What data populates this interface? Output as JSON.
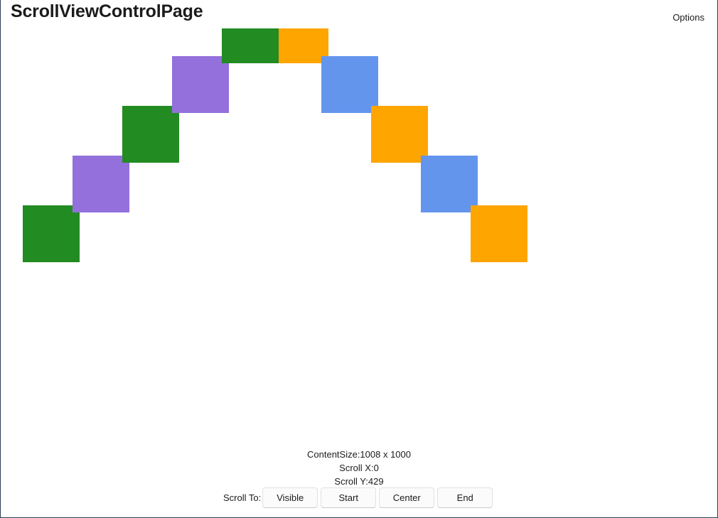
{
  "page": {
    "title": "ScrollViewControlPage",
    "options_label": "Options"
  },
  "colors": {
    "green": "#228b22",
    "orange": "#ffa500",
    "purple": "#9370db",
    "blue": "#6495ed"
  },
  "boxes": [
    {
      "name": "green-box-1",
      "color": "green"
    },
    {
      "name": "purple-box-1",
      "color": "purple"
    },
    {
      "name": "green-box-2",
      "color": "green"
    },
    {
      "name": "purple-box-2",
      "color": "purple"
    },
    {
      "name": "green-box-3",
      "color": "green"
    },
    {
      "name": "orange-box-1",
      "color": "orange"
    },
    {
      "name": "blue-box-1",
      "color": "blue"
    },
    {
      "name": "orange-box-2",
      "color": "orange"
    },
    {
      "name": "blue-box-2",
      "color": "blue"
    },
    {
      "name": "orange-box-3",
      "color": "orange"
    }
  ],
  "info": {
    "content_size": "ContentSize:1008 x 1000",
    "scroll_x": "Scroll X:0",
    "scroll_y": "Scroll Y:429"
  },
  "scroll_to": {
    "label": "Scroll To:",
    "buttons": [
      "Visible",
      "Start",
      "Center",
      "End"
    ]
  }
}
